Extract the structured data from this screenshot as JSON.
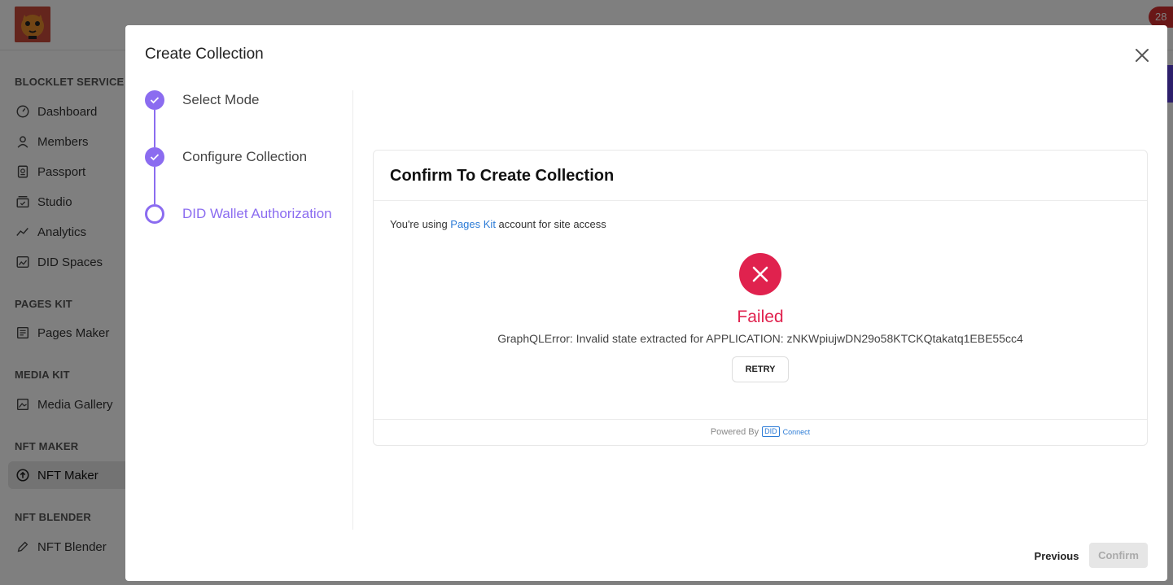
{
  "background": {
    "notification_count": "28",
    "sidebar": {
      "sections": [
        {
          "title": "BLOCKLET SERVICE",
          "items": [
            {
              "label": "Dashboard",
              "icon": "dashboard-icon"
            },
            {
              "label": "Members",
              "icon": "person-icon"
            },
            {
              "label": "Passport",
              "icon": "passport-icon"
            },
            {
              "label": "Studio",
              "icon": "studio-icon"
            },
            {
              "label": "Analytics",
              "icon": "analytics-icon"
            },
            {
              "label": "DID Spaces",
              "icon": "did-spaces-icon"
            }
          ]
        },
        {
          "title": "PAGES KIT",
          "items": [
            {
              "label": "Pages Maker",
              "icon": "pages-icon"
            }
          ]
        },
        {
          "title": "MEDIA KIT",
          "items": [
            {
              "label": "Media Gallery",
              "icon": "gallery-icon"
            }
          ]
        },
        {
          "title": "NFT MAKER",
          "items": [
            {
              "label": "NFT Maker",
              "icon": "upload-circle-icon",
              "active": true
            }
          ]
        },
        {
          "title": "NFT BLENDER",
          "items": [
            {
              "label": "NFT Blender",
              "icon": "pen-icon"
            }
          ]
        }
      ]
    }
  },
  "modal": {
    "title": "Create Collection",
    "steps": [
      {
        "label": "Select Mode",
        "state": "done"
      },
      {
        "label": "Configure Collection",
        "state": "done"
      },
      {
        "label": "DID Wallet Authorization",
        "state": "current"
      }
    ],
    "card": {
      "title": "Confirm To Create Collection",
      "account_prefix": "You're using ",
      "account_link": "Pages Kit",
      "account_suffix": " account for site access",
      "status": "Failed",
      "error": "GraphQLError: Invalid state extracted for APPLICATION: zNKWpiujwDN29o58KTCKQtakatq1EBE55cc4",
      "retry_label": "RETRY",
      "powered_by": "Powered By",
      "did_badge": "DID",
      "connect": "Connect"
    },
    "previous_label": "Previous",
    "confirm_label": "Confirm"
  },
  "colors": {
    "accent": "#8b6cf0",
    "error": "#e0224e",
    "link": "#2b7bd6"
  }
}
